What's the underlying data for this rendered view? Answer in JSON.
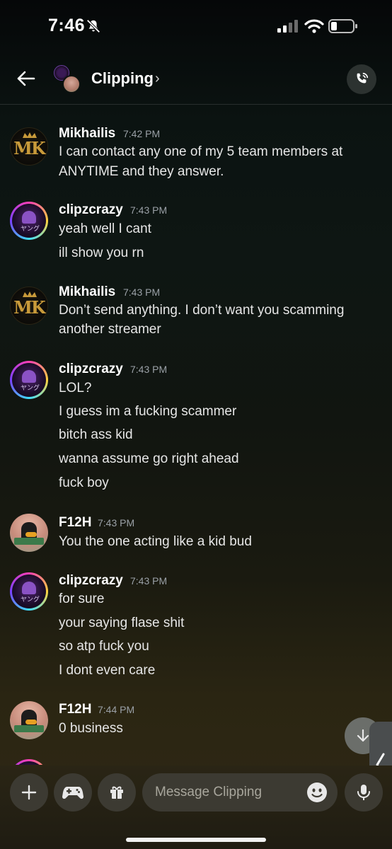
{
  "status_bar": {
    "time": "7:46"
  },
  "header": {
    "title": "Clipping",
    "chevron": "›"
  },
  "messages": [
    {
      "author": "Mikhailis",
      "time": "7:42 PM",
      "lines": [
        "I can contact any one of my 5 team members at",
        "ANYTIME and they answer."
      ]
    },
    {
      "author": "clipzcrazy",
      "time": "7:43 PM",
      "lines": [
        "yeah well I cant",
        "ill show you rn"
      ]
    },
    {
      "author": "Mikhailis",
      "time": "7:43 PM",
      "lines": [
        "Don’t send anything. I don’t want you scamming",
        "another streamer"
      ]
    },
    {
      "author": "clipzcrazy",
      "time": "7:43 PM",
      "lines": [
        "LOL?",
        "I guess im a fucking scammer",
        "bitch ass kid",
        "wanna assume go right ahead",
        "fuck boy"
      ]
    },
    {
      "author": "F12H",
      "time": "7:43 PM",
      "lines": [
        "You the one acting like a kid bud"
      ]
    },
    {
      "author": "clipzcrazy",
      "time": "7:43 PM",
      "lines": [
        "for sure",
        "your saying flase shit",
        "so atp fuck you",
        "I dont even care"
      ]
    },
    {
      "author": "F12H",
      "time": "7:44 PM",
      "lines": [
        "0 business"
      ]
    }
  ],
  "avatars": {
    "mk_letters": "MK",
    "clipz_glyph": "ヤング"
  },
  "composer": {
    "placeholder": "Message Clipping"
  },
  "icons": [
    "bell-slash-icon",
    "signal-icon",
    "wifi-icon",
    "battery-icon",
    "back-arrow-icon",
    "phone-call-icon",
    "plus-icon",
    "gamepad-icon",
    "gift-icon",
    "emoji-icon",
    "microphone-icon",
    "arrow-down-icon",
    "chevron-left-icon"
  ],
  "colors": {
    "timestamp": "#9aa0a6",
    "mk_gold": "#c89a3a",
    "button_bg": "#3c3a32"
  }
}
